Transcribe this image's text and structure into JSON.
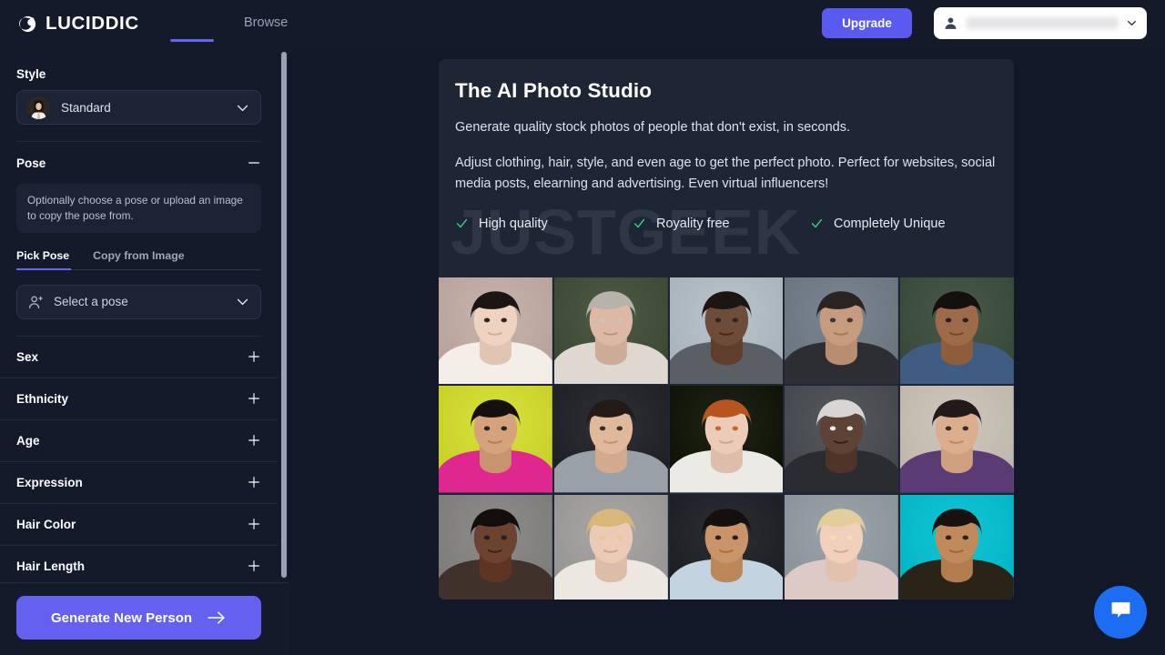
{
  "header": {
    "brand_name": "LUCIDDIC",
    "brand_icon": "crescent-moon-icon",
    "nav_browse": "Browse",
    "upgrade_label": "Upgrade",
    "account_name": "",
    "account_icon": "person-icon",
    "account_caret_icon": "chevron-down-icon"
  },
  "sidebar": {
    "style": {
      "label": "Style",
      "selected": "Standard",
      "thumbnail_icon": "person-avatar-thumbnail",
      "caret_icon": "chevron-down-icon"
    },
    "pose": {
      "label": "Pose",
      "toggle_icon": "minus-icon",
      "hint": "Optionally choose a pose or upload an image to copy the pose from.",
      "tabs": [
        {
          "label": "Pick Pose",
          "active": true
        },
        {
          "label": "Copy from Image",
          "active": false
        }
      ],
      "select_placeholder": "Select a pose",
      "select_icon": "person-add-icon",
      "caret_icon": "chevron-down-icon"
    },
    "accordions": [
      {
        "label": "Sex",
        "toggle_icon": "plus-icon"
      },
      {
        "label": "Ethnicity",
        "toggle_icon": "plus-icon"
      },
      {
        "label": "Age",
        "toggle_icon": "plus-icon"
      },
      {
        "label": "Expression",
        "toggle_icon": "plus-icon"
      },
      {
        "label": "Hair Color",
        "toggle_icon": "plus-icon"
      },
      {
        "label": "Hair Length",
        "toggle_icon": "plus-icon"
      }
    ],
    "generate_button": {
      "label": "Generate New Person",
      "icon": "arrow-right-icon"
    },
    "scrollbar_name": "sidebar-scrollbar"
  },
  "main": {
    "title": "The AI Photo Studio",
    "subtitle": "Generate quality stock photos of people that don't exist, in seconds.",
    "body": "Adjust clothing, hair, style, and even age to get the perfect photo. Perfect for websites, social media posts, elearning and advertising. Even virtual influencers!",
    "watermark": "JUSTGEEK",
    "features": [
      {
        "label": "High quality",
        "icon": "check-icon"
      },
      {
        "label": "Royality free",
        "icon": "check-icon"
      },
      {
        "label": "Completely Unique",
        "icon": "check-icon"
      }
    ],
    "photos": [
      {
        "alt": "asian-woman-white-dress",
        "bg": "#c9b4ad",
        "skin": "#efd3c0",
        "hair": "#1b1614",
        "cloth": "#f3eee8"
      },
      {
        "alt": "older-man-grey-beard-light-suit",
        "bg": "#4d5a46",
        "skin": "#dcb9a4",
        "hair": "#b8b2ad",
        "cloth": "#ded8d0"
      },
      {
        "alt": "black-man-dark-suit-tie",
        "bg": "#b9c4cc",
        "skin": "#6d4c39",
        "hair": "#1c1513",
        "cloth": "#5a5f66"
      },
      {
        "alt": "asian-older-man-dark-jacket",
        "bg": "#7b8691",
        "skin": "#c79c7e",
        "hair": "#2a2522",
        "cloth": "#2c2e33"
      },
      {
        "alt": "indian-man-blue-shirt",
        "bg": "#4a5a4a",
        "skin": "#9d6a4a",
        "hair": "#14100e",
        "cloth": "#3f5d82"
      },
      {
        "alt": "woman-colorful-backdrop-makeup",
        "bg": "#d9e23a",
        "skin": "#d6a27e",
        "hair": "#15100f",
        "cloth": "#e0268f"
      },
      {
        "alt": "asian-woman-grey-blazer",
        "bg": "#2f3136",
        "skin": "#e0b89c",
        "hair": "#241b17",
        "cloth": "#9aa0a8"
      },
      {
        "alt": "redhead-woman-white-shirt",
        "bg": "#1f2417",
        "skin": "#eccbb8",
        "hair": "#b8541f",
        "cloth": "#eceae4"
      },
      {
        "alt": "older-black-man-moustache",
        "bg": "#55585c",
        "skin": "#5d4235",
        "hair": "#d8d6d2",
        "cloth": "#2a2c30"
      },
      {
        "alt": "woman-long-dark-hair-purple-top",
        "bg": "#cfc8bd",
        "skin": "#dcae8e",
        "hair": "#24191a",
        "cloth": "#5b3b74"
      },
      {
        "alt": "black-woman-curly-hair",
        "bg": "#8e8d8b",
        "skin": "#6b4330",
        "hair": "#120e0d",
        "cloth": "#41312b"
      },
      {
        "alt": "blonde-woman-white-jacket",
        "bg": "#a8a7a5",
        "skin": "#eccbb6",
        "hair": "#d8b579",
        "cloth": "#ece7e0"
      },
      {
        "alt": "middle-eastern-man-light-blue-shirt",
        "bg": "#2d2f33",
        "skin": "#c99468",
        "hair": "#14100f",
        "cloth": "#c4d3e0"
      },
      {
        "alt": "blonde-woman-pink-turtleneck",
        "bg": "#9ba4ab",
        "skin": "#f0d0bb",
        "hair": "#e3cd9b",
        "cloth": "#ddc9c6"
      },
      {
        "alt": "two-men-cyan-backdrop-costume",
        "bg": "#12c6d6",
        "skin": "#c08a5c",
        "hair": "#17110f",
        "cloth": "#2a2418"
      }
    ]
  },
  "chat": {
    "icon": "chat-bubble-icon",
    "name": "chat-support-button"
  },
  "colors": {
    "page_bg": "#121827",
    "panel_bg": "#141A2A",
    "card_bg": "#1e2636",
    "accent_purple": "#6366f1",
    "upgrade_purple": "#5a59f0",
    "generate_purple": "#6560f0",
    "check_green": "#3ddc8e",
    "chat_blue": "#1d6df3",
    "text_primary": "#ffffff",
    "text_muted": "#98a0b3"
  }
}
